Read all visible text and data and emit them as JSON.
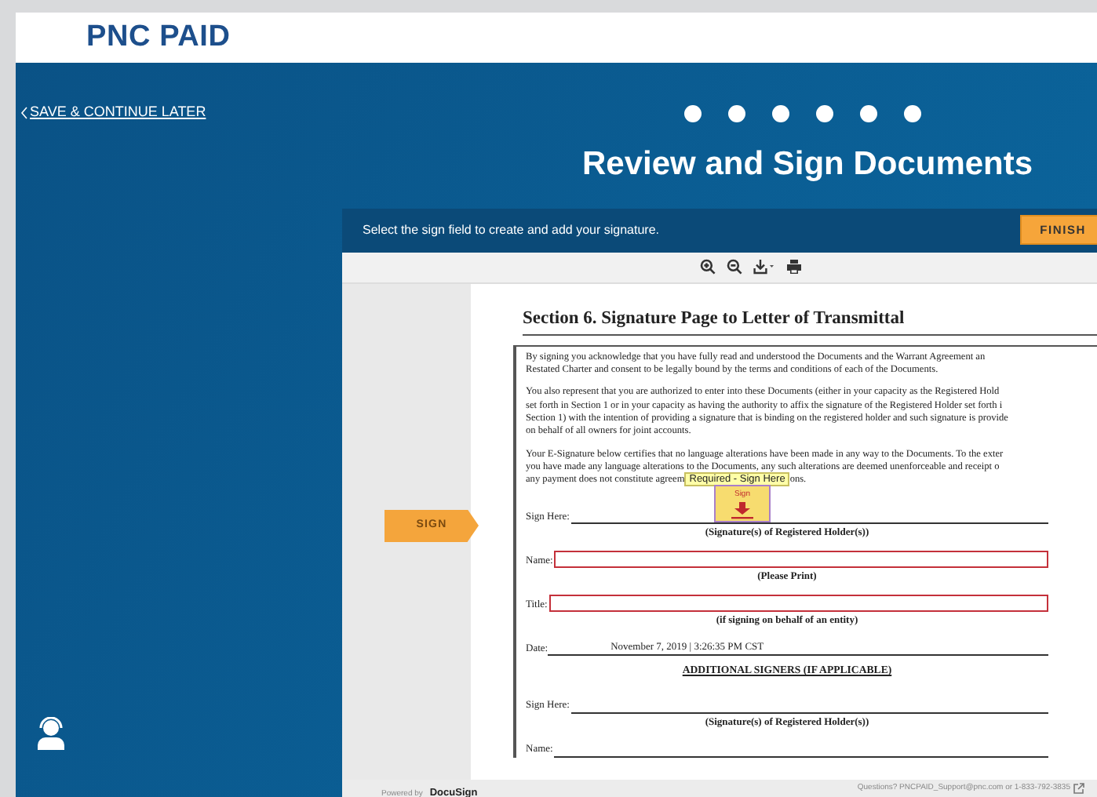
{
  "header": {
    "logo": "PNC PAID"
  },
  "save_link": "SAVE & CONTINUE LATER",
  "page_title": "Review and Sign Documents",
  "signing": {
    "instruction": "Select the sign field to create and add your signature.",
    "finish_button": "FINISH",
    "sign_tab": "SIGN",
    "document": {
      "heading": "Section 6.  Signature Page to Letter of Transmittal",
      "paragraphs": [
        [
          "By signing you acknowledge that you have fully read and understood the Documents and the Warrant Agreement an",
          "Restated Charter and consent to be legally bound by the terms and conditions of each of the Documents."
        ],
        [
          "You also represent that you are authorized to enter into these Documents (either in your capacity as the Registered Hold",
          "set forth in Section 1 or in your capacity as having the authority to affix the signature of the Registered Holder set forth i",
          "Section 1) with the intention of providing a signature that is binding on the registered holder and such signature is provide",
          "on behalf of all owners for joint accounts."
        ],
        [
          "Your E-Signature below certifies that no language alterations have been made in any way to the Documents.  To the exter",
          "you have made any language alterations to the Documents, any such alterations are deemed unenforceable and receipt o"
        ]
      ],
      "tooltip_line": {
        "before": "any payment does not constitute agreem",
        "tooltip": "Required - Sign Here",
        "after": "ons."
      },
      "sign_tag": "Sign",
      "form": [
        {
          "kind": "line",
          "label": "Sign Here:",
          "caption": "(Signature(s) of Registered Holder(s))"
        },
        {
          "kind": "field",
          "label": "Name:",
          "caption": "(Please Print)"
        },
        {
          "kind": "field",
          "label": "Title:",
          "caption": "(if signing on behalf of an entity)"
        },
        {
          "kind": "value",
          "label": "Date:",
          "value": "November 7, 2019 | 3:26:35 PM CST"
        },
        {
          "kind": "heading",
          "text": "ADDITIONAL SIGNERS (IF APPLICABLE)"
        },
        {
          "kind": "line",
          "label": "Sign Here:",
          "caption": "(Signature(s) of Registered Holder(s))"
        },
        {
          "kind": "line",
          "label": "Name:"
        }
      ]
    }
  },
  "footer": {
    "powered_by": "Powered by",
    "brand": "DocuSign",
    "contact": "Questions? PNCPAID_Support@pnc.com or 1-833-792-3835"
  }
}
